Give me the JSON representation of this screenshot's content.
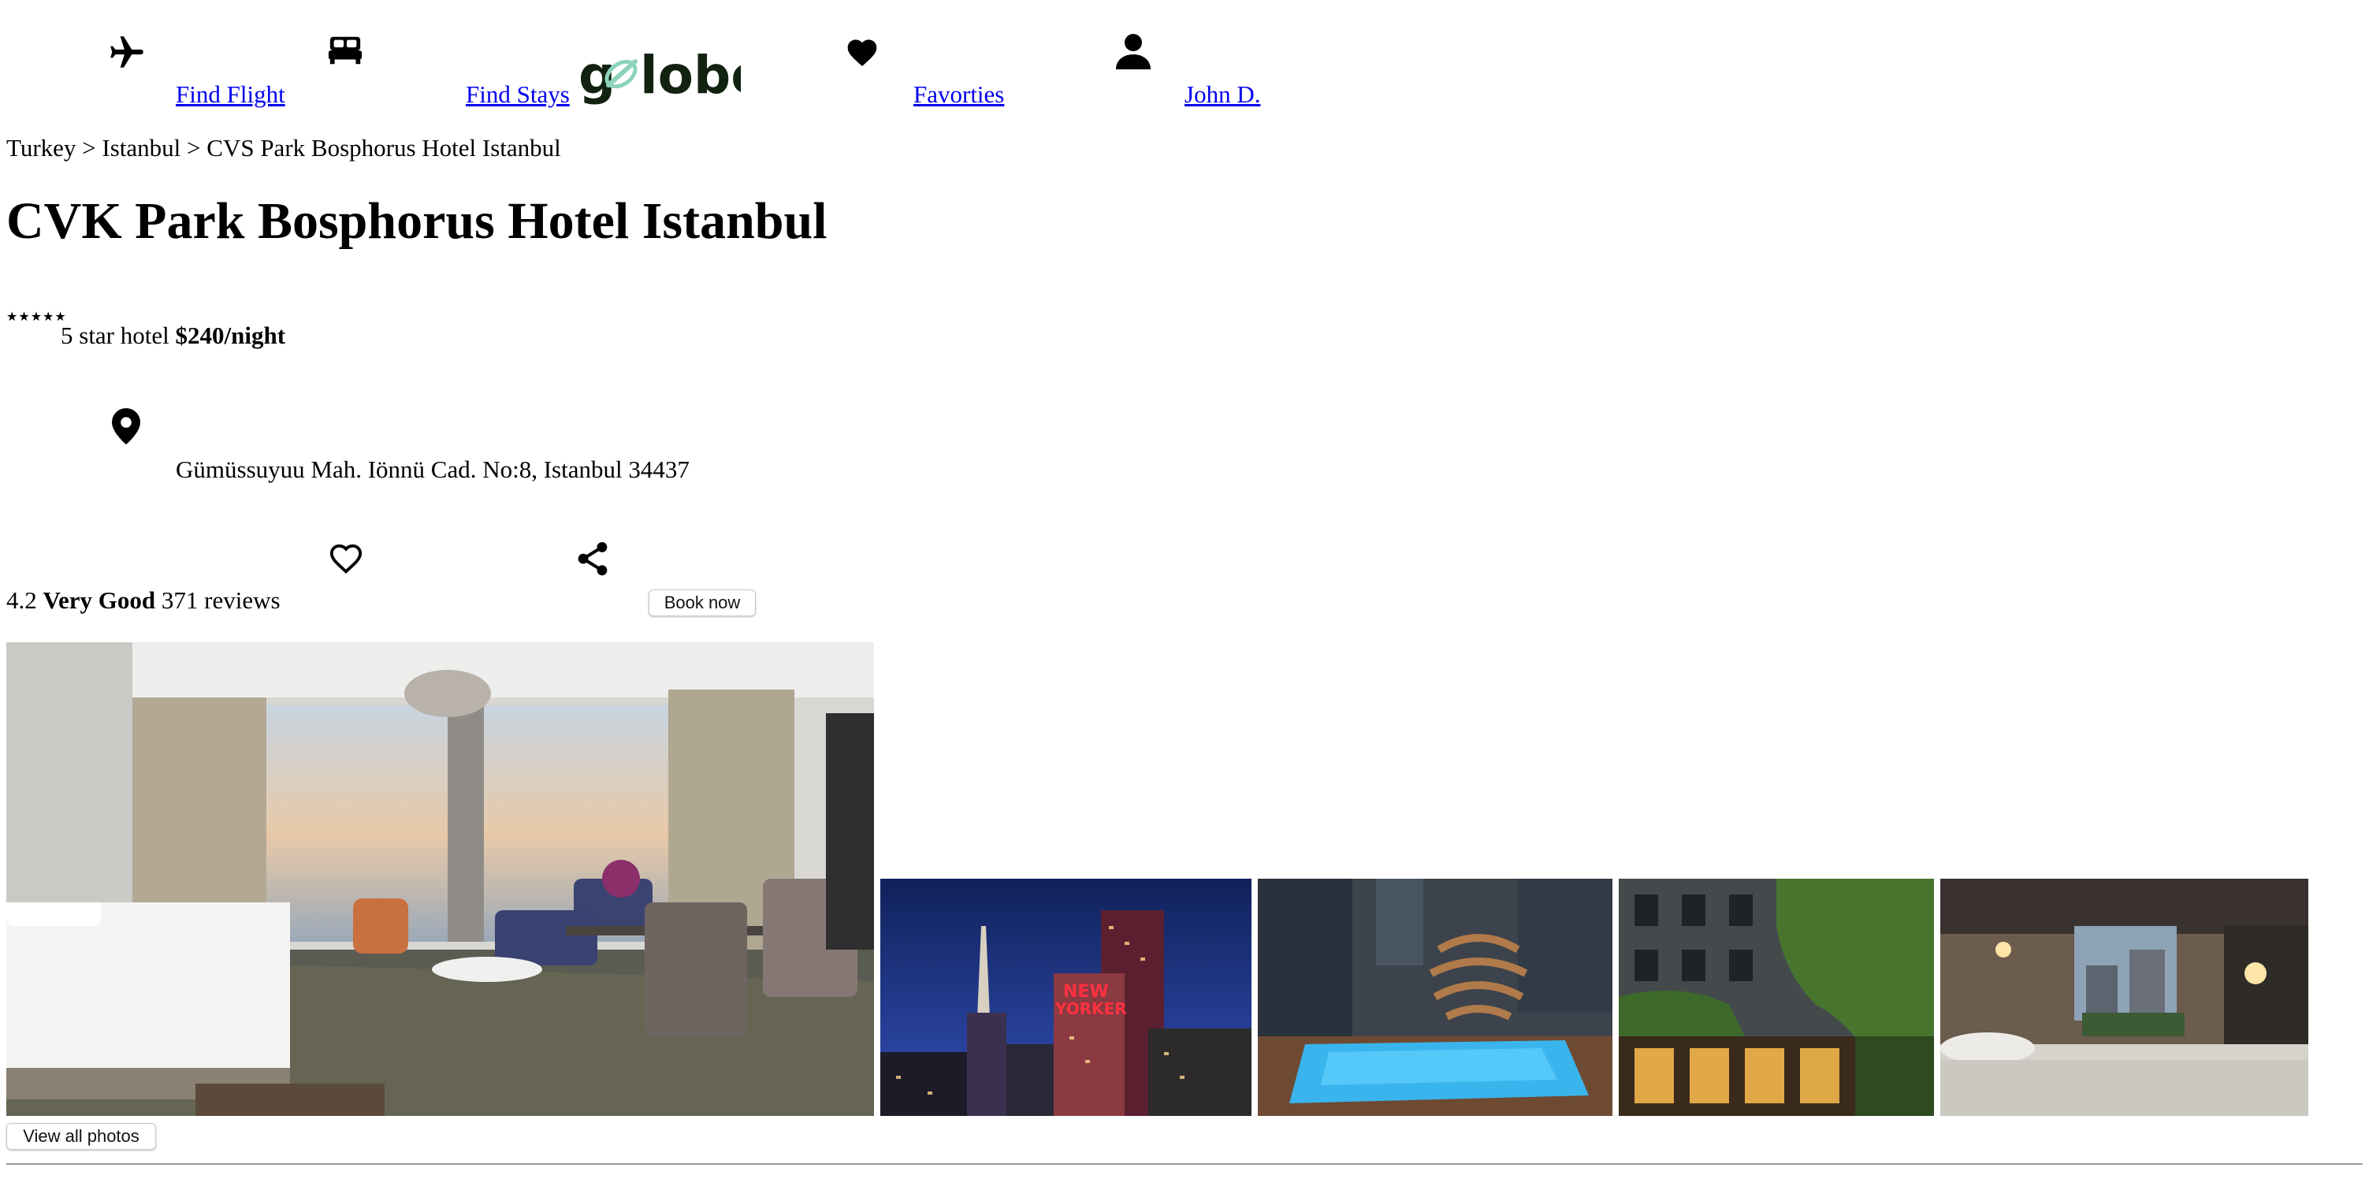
{
  "nav": {
    "find_flight": "Find Flight",
    "find_stays": "Find Stays",
    "favorites": "Favorties",
    "user": "John D.",
    "logo_text": "golobe",
    "logo_accent": "#8DD3BB"
  },
  "breadcrumb": "Turkey > Istanbul > CVS Park Bosphorus Hotel Istanbul",
  "hotel": {
    "name": "CVK Park Bosphorus Hotel Istanbul",
    "stars_glyph": "★★★★★",
    "star_rating": 5,
    "star_label": "5 star hotel",
    "price": "$240/night",
    "address": "Gümüssuyuu Mah. Iönnü Cad. No:8, Istanbul 34437",
    "rating_score": "4.2",
    "rating_word": "Very Good",
    "reviews": "371 reviews"
  },
  "actions": {
    "book_now": "Book now",
    "view_all_photos": "View all photos"
  },
  "icons": {
    "flight": "airplane-icon",
    "stays": "bed-icon",
    "favorites": "heart-icon",
    "user": "user-icon",
    "location": "location-pin-icon",
    "favorite_toggle": "heart-outline-icon",
    "share": "share-icon"
  },
  "photos": [
    {
      "subject": "hotel room with bed and sofa by window"
    },
    {
      "subject": "New Yorker hotel at night skyline"
    },
    {
      "subject": "rooftop pool with vessel structure"
    },
    {
      "subject": "hotel facade with green ivy"
    },
    {
      "subject": "bedroom with city view window"
    }
  ]
}
